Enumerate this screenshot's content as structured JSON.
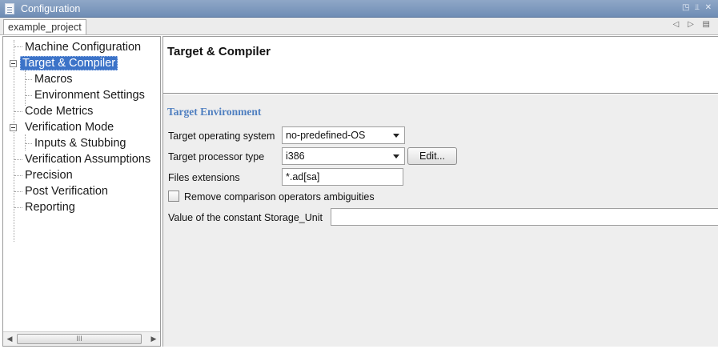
{
  "window": {
    "title": "Configuration",
    "controls": "◳ ⫫ ✕"
  },
  "project_tab": {
    "label": "example_project",
    "nav": "◁ ▷ ▤"
  },
  "tree": {
    "items": [
      {
        "label": "Machine Configuration"
      },
      {
        "label": "Target & Compiler",
        "selected": true,
        "expanded": true
      },
      {
        "label": "Macros"
      },
      {
        "label": "Environment Settings"
      },
      {
        "label": "Code Metrics"
      },
      {
        "label": "Verification Mode",
        "expanded": true
      },
      {
        "label": "Inputs & Stubbing"
      },
      {
        "label": "Verification Assumptions"
      },
      {
        "label": "Precision"
      },
      {
        "label": "Post Verification"
      },
      {
        "label": "Reporting"
      }
    ],
    "scrollbar_left": "◀",
    "scrollbar_right": "▶",
    "scrollbar_thumb": "III"
  },
  "content": {
    "title": "Target & Compiler",
    "section": "Target Environment",
    "target_os_label": "Target operating system",
    "target_os_value": "no-predefined-OS",
    "processor_label": "Target processor type",
    "processor_value": "i386",
    "edit_button": "Edit...",
    "files_ext_label": "Files extensions",
    "files_ext_value": "*.ad[sa]",
    "remove_ambiguities_label": "Remove comparison operators ambiguities",
    "remove_ambiguities_checked": false,
    "storage_unit_label": "Value of the constant Storage_Unit",
    "storage_unit_value": ""
  }
}
